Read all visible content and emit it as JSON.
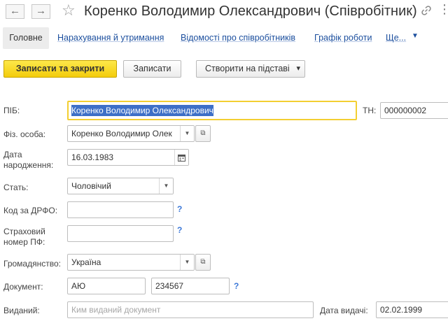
{
  "header": {
    "back_glyph": "←",
    "forward_glyph": "→",
    "star_glyph": "☆",
    "title": "Коренко Володимир Олександрович (Співробітник)",
    "more_glyph": "⋮"
  },
  "tabs": {
    "active": "Головне",
    "links": [
      "Нарахування й утримання",
      "Відомості про співробітників",
      "Графік роботи",
      "Ще..."
    ],
    "caret": "▼"
  },
  "toolbar": {
    "save_close_label": "Записати та закрити",
    "save_label": "Записати",
    "create_based_label": "Створити на підставі",
    "create_based_caret": "▾"
  },
  "form": {
    "pib": {
      "label": "ПІБ:",
      "value": "Коренко Володимир Олександрович"
    },
    "tn": {
      "label": "ТН:",
      "value": "000000002"
    },
    "individual": {
      "label": "Фіз. особа:",
      "value": "Коренко Володимир Олек"
    },
    "birth_date": {
      "label_line1": "Дата",
      "label_line2": "народження:",
      "value": "16.03.1983"
    },
    "gender": {
      "label": "Стать:",
      "value": "Чоловічий"
    },
    "drfo": {
      "label": "Код за ДРФО:",
      "value": ""
    },
    "insurance": {
      "label_line1": "Страховий",
      "label_line2": "номер ПФ:",
      "value": ""
    },
    "citizenship": {
      "label": "Громадянство:",
      "value": "Україна"
    },
    "document": {
      "label": "Документ:",
      "series": "АЮ",
      "number": "234567"
    },
    "issued_by": {
      "label": "Виданий:",
      "placeholder": "Ким виданий документ"
    },
    "issue_date": {
      "label": "Дата видачі:",
      "value": "02.02.1999"
    },
    "help_glyph": "?",
    "dropdown_glyph": "▼",
    "open_glyph": "⧉"
  },
  "colors": {
    "primary_button": "#f3cc0c",
    "focus_border": "#f3cf32",
    "link": "#1c4f9e",
    "selection": "#3d6fc7"
  }
}
